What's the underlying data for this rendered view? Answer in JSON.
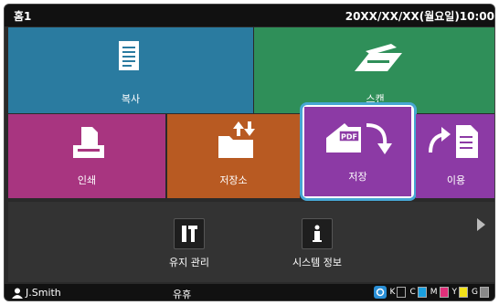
{
  "topbar": {
    "title": "홈1",
    "datetime": "20XX/XX/XX(월요일)10:00"
  },
  "tiles": {
    "copy": "복사",
    "scan": "스캔",
    "print": "인쇄",
    "storage": "저장소",
    "save": "저장",
    "use": "이용"
  },
  "shortcuts": {
    "maintenance": "유지 관리",
    "system_info": "시스템 정보"
  },
  "footer": {
    "user": "J.Smith",
    "status": "유휴",
    "toners": [
      {
        "letter": "K",
        "color": "#111111"
      },
      {
        "letter": "C",
        "color": "#1aa0e0"
      },
      {
        "letter": "M",
        "color": "#e0307a"
      },
      {
        "letter": "Y",
        "color": "#f2e21a"
      },
      {
        "letter": "G",
        "color": "#888888"
      }
    ]
  },
  "colors": {
    "copy_tile": "#2a7ba0",
    "scan_tile": "#2f8f59",
    "print_tile": "#a83580",
    "storage_tile": "#b85a22",
    "save_tile": "#8c3aa5",
    "use_tile": "#8c3aa5",
    "highlight_frame": "#47a6d3"
  },
  "icons": {
    "copy": "document-stack-icon",
    "scan": "scanner-icon",
    "print": "printer-icon",
    "storage": "folder-upload-download-icon",
    "save": "pdf-save-icon",
    "use": "document-use-icon",
    "maintenance": "tools-icon",
    "system_info": "info-icon",
    "user": "user-icon",
    "next": "right-arrow-icon"
  }
}
